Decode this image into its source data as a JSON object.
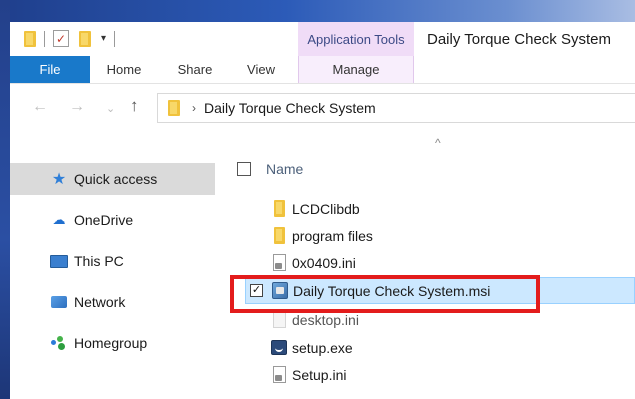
{
  "window": {
    "title": "Daily Torque Check System"
  },
  "quick_access_toolbar": {
    "dropdown_glyph": "▾",
    "check_glyph": "✓"
  },
  "ribbon": {
    "context_group_label": "Application Tools",
    "tabs": [
      {
        "label": "File",
        "active": true
      },
      {
        "label": "Home"
      },
      {
        "label": "Share"
      },
      {
        "label": "View"
      },
      {
        "label": "Manage"
      }
    ]
  },
  "navigation": {
    "back_glyph": "←",
    "forward_glyph": "→",
    "recent_glyph": "⌄",
    "up_glyph": "↑",
    "breadcrumb_separator": "›",
    "path": "Daily Torque Check System"
  },
  "nav_pane": {
    "items": [
      {
        "label": "Quick access",
        "icon": "star-icon",
        "selected": true
      },
      {
        "label": "OneDrive",
        "icon": "cloud-icon"
      },
      {
        "label": "This PC",
        "icon": "computer-icon"
      },
      {
        "label": "Network",
        "icon": "network-icon"
      },
      {
        "label": "Homegroup",
        "icon": "homegroup-icon"
      }
    ]
  },
  "file_list": {
    "sort_glyph": "^",
    "column_header": "Name",
    "files": [
      {
        "name": "LCDClibdb",
        "type": "folder"
      },
      {
        "name": "program files",
        "type": "folder"
      },
      {
        "name": "0x0409.ini",
        "type": "ini"
      },
      {
        "name": "Daily Torque Check System.msi",
        "type": "msi",
        "selected": true,
        "checked": true,
        "highlighted": true
      },
      {
        "name": "desktop.ini",
        "type": "hidden-ini"
      },
      {
        "name": "setup.exe",
        "type": "exe"
      },
      {
        "name": "Setup.ini",
        "type": "ini"
      }
    ]
  },
  "colors": {
    "file_tab": "#1979ca",
    "application_tools": "#f0dcf7",
    "selection": "#cce8ff",
    "highlight_box": "#e31c1c"
  }
}
